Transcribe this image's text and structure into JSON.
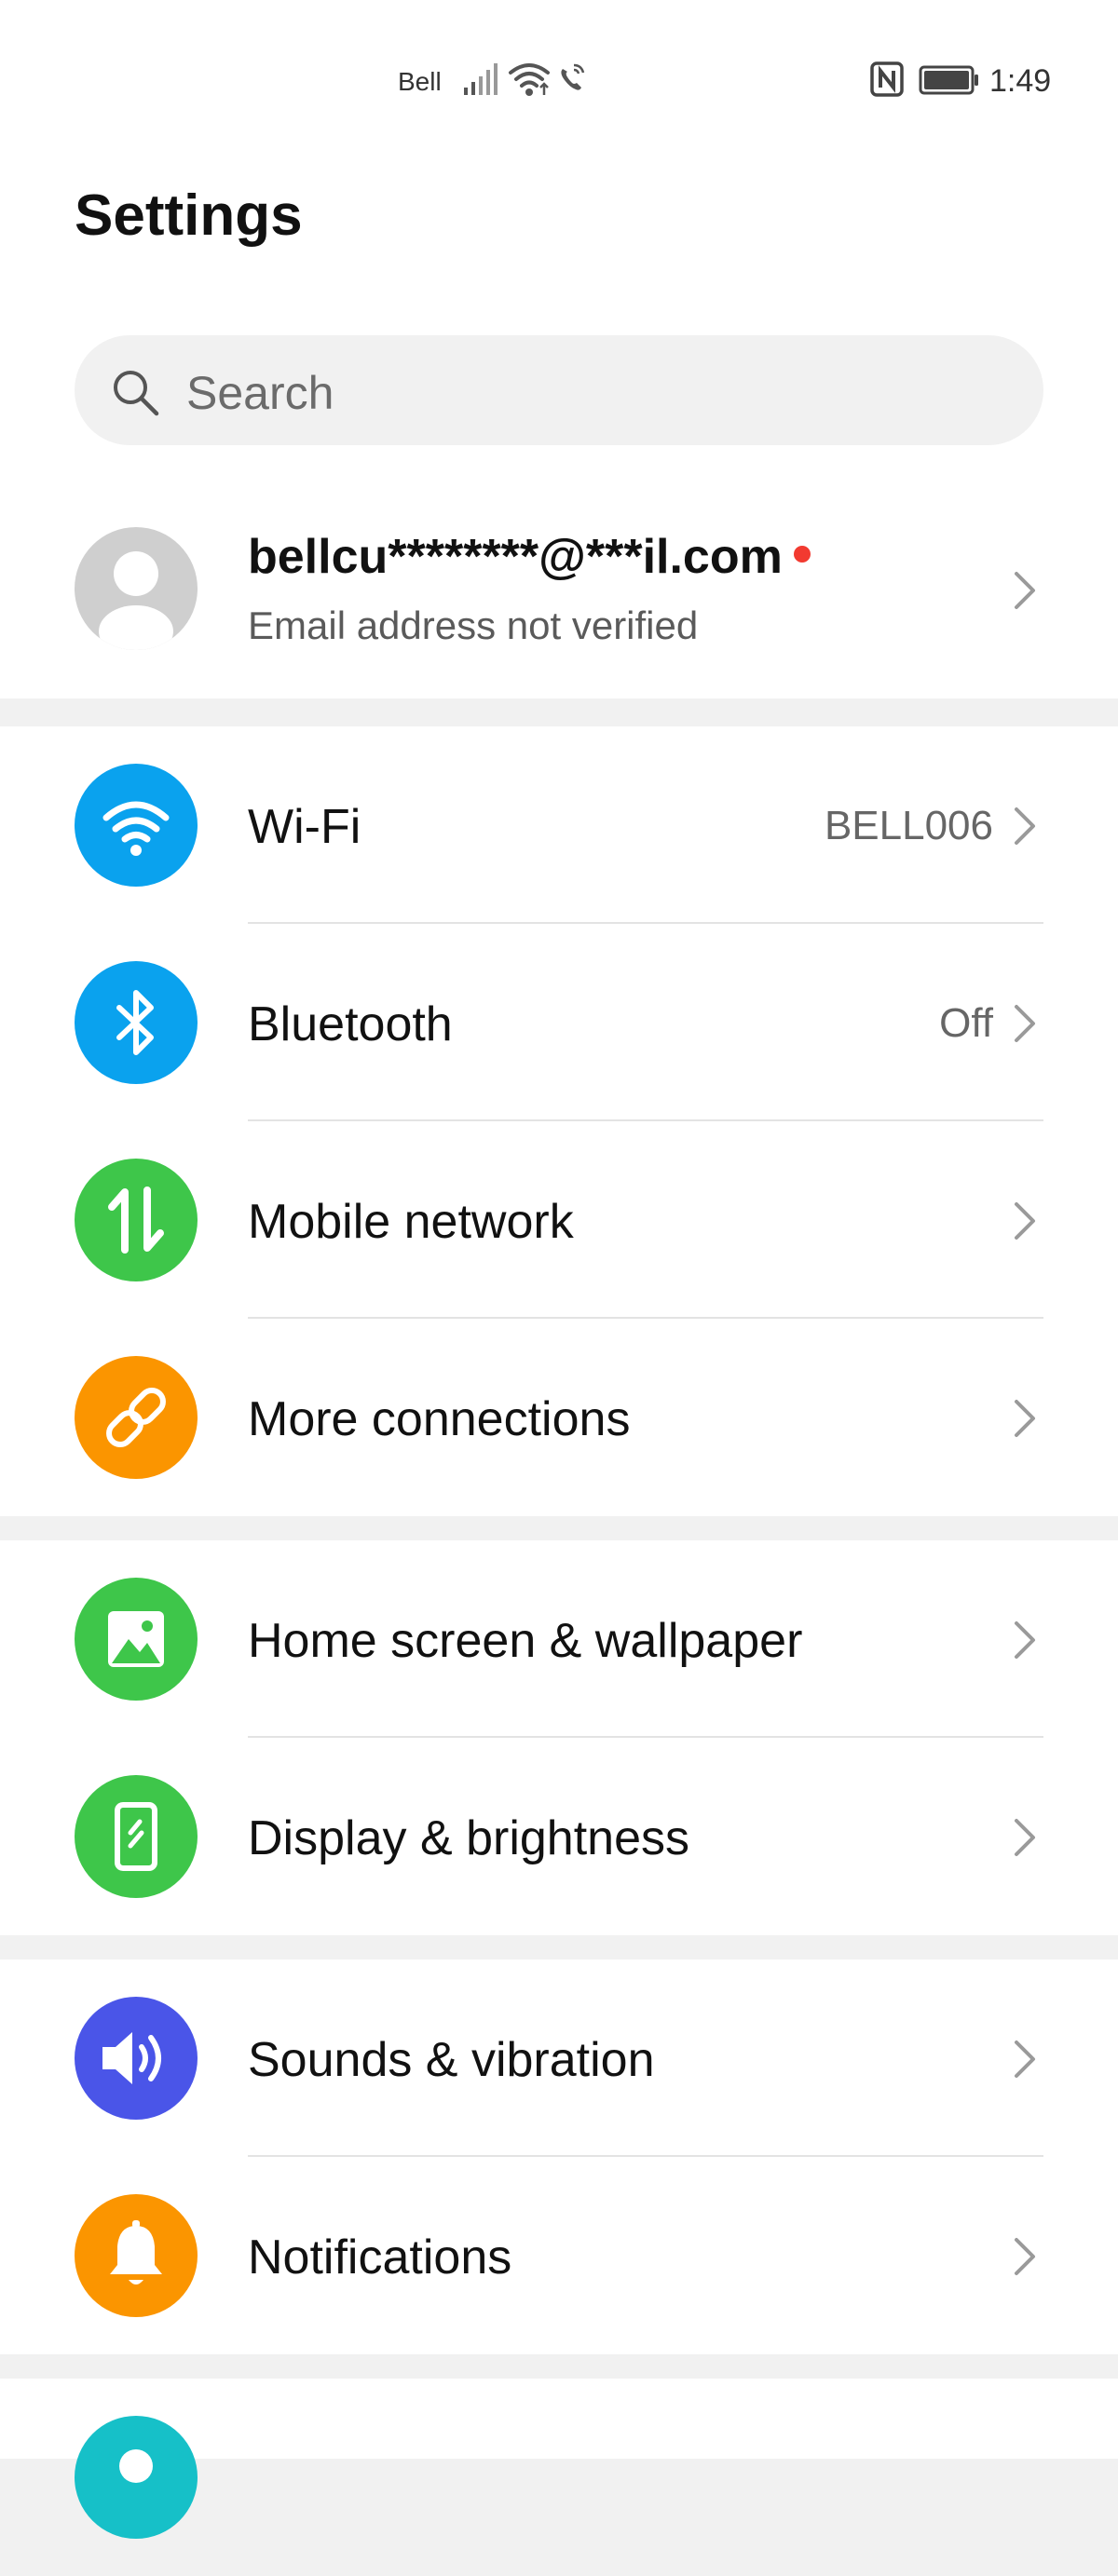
{
  "status_bar": {
    "carrier": "Bell",
    "time": "1:49",
    "icons": [
      "signal-icon",
      "wifi-icon",
      "wifi-calling-icon",
      "nfc-icon",
      "battery-icon"
    ]
  },
  "header": {
    "title": "Settings"
  },
  "search": {
    "placeholder": "Search"
  },
  "account": {
    "email": "bellcu********@***il.com",
    "subtitle": "Email address not verified",
    "has_notification_dot": true
  },
  "groups": [
    {
      "items": [
        {
          "label": "Wi-Fi",
          "value": "BELL006",
          "icon": "wifi-icon",
          "color": "#0aa2ee"
        },
        {
          "label": "Bluetooth",
          "value": "Off",
          "icon": "bluetooth-icon",
          "color": "#0aa2ee"
        },
        {
          "label": "Mobile network",
          "value": "",
          "icon": "mobile-data-icon",
          "color": "#3ec64a"
        },
        {
          "label": "More connections",
          "value": "",
          "icon": "link-icon",
          "color": "#fb9500"
        }
      ]
    },
    {
      "items": [
        {
          "label": "Home screen & wallpaper",
          "value": "",
          "icon": "wallpaper-icon",
          "color": "#3ec64a"
        },
        {
          "label": "Display & brightness",
          "value": "",
          "icon": "display-icon",
          "color": "#3ec64a"
        }
      ]
    },
    {
      "items": [
        {
          "label": "Sounds & vibration",
          "value": "",
          "icon": "speaker-icon",
          "color": "#4a55e8"
        },
        {
          "label": "Notifications",
          "value": "",
          "icon": "bell-icon",
          "color": "#fb9500"
        }
      ]
    },
    {
      "items": [
        {
          "label": "",
          "value": "",
          "icon": "user-icon",
          "color": "#16c0c8"
        }
      ]
    }
  ]
}
